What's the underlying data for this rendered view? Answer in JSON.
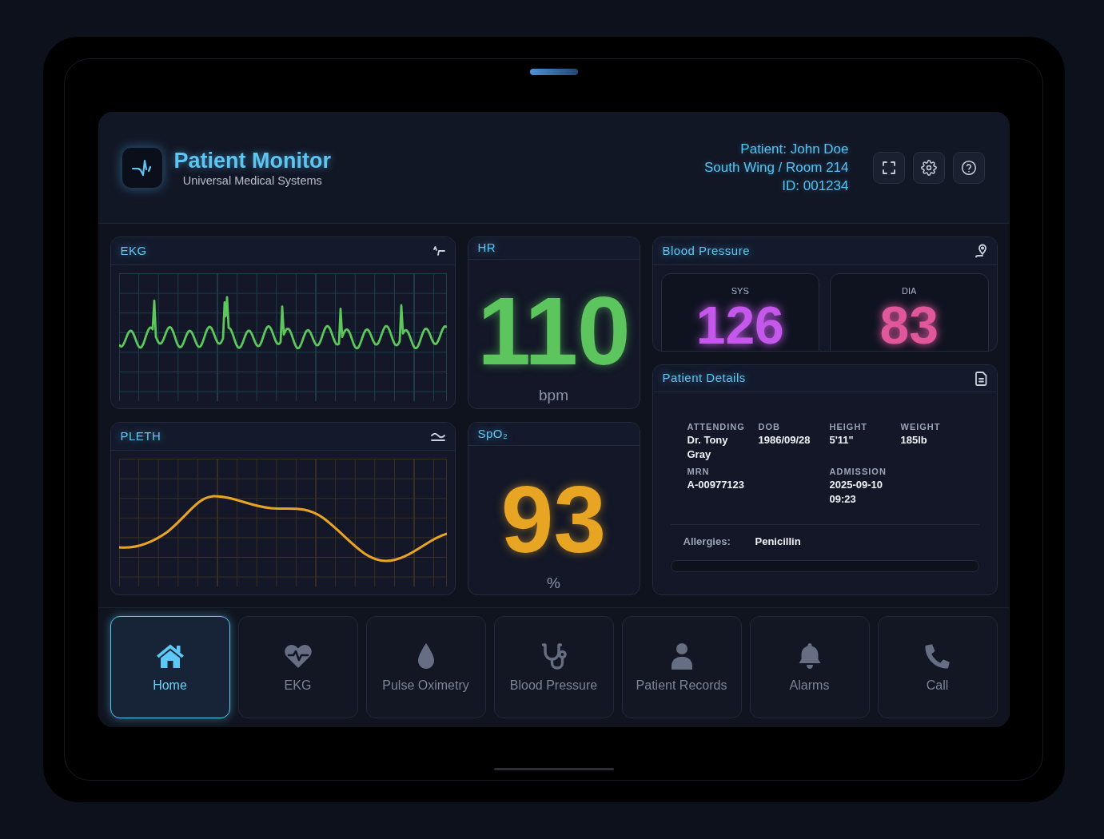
{
  "header": {
    "title": "Patient Monitor",
    "subtitle": "Universal Medical Systems",
    "patient_lines": [
      "Patient: John Doe",
      "South Wing / Room 214",
      "ID: 001234"
    ]
  },
  "ekg": {
    "title": "EKG"
  },
  "hr": {
    "title": "HR",
    "value": "110",
    "unit": "bpm"
  },
  "blood_pressure": {
    "title": "Blood Pressure",
    "readings": [
      {
        "label": "SYS",
        "value": "126",
        "color": "#c458ea"
      },
      {
        "label": "DIA",
        "value": "83",
        "color": "#e0579c"
      }
    ]
  },
  "pleth": {
    "title": "PLETH"
  },
  "spo2": {
    "title": "SpO₂",
    "value": "93",
    "unit": "%"
  },
  "patient_details": {
    "title": "Patient Details",
    "rows": [
      [
        {
          "label": "ATTENDING",
          "value": "Dr. Tony Gray"
        },
        {
          "label": "DOB",
          "value": "1986/09/28"
        },
        {
          "label": "HEIGHT",
          "value": "5'11\""
        },
        {
          "label": "WEIGHT",
          "value": "185lb"
        }
      ],
      [
        {
          "label": "MRN",
          "value": "A-00977123"
        },
        "",
        {
          "label": "ADMISSION",
          "value": "2025-09-10 09:23"
        }
      ]
    ],
    "allergies": {
      "label": "Allergies:",
      "value": "Penicillin"
    }
  },
  "nav": [
    {
      "label": "Home",
      "selected": true
    },
    {
      "label": "EKG",
      "selected": false
    },
    {
      "label": "Pulse Oximetry",
      "selected": false
    },
    {
      "label": "Blood Pressure",
      "selected": false
    },
    {
      "label": "Patient Records",
      "selected": false
    },
    {
      "label": "Alarms",
      "selected": false
    },
    {
      "label": "Call",
      "selected": false
    }
  ]
}
